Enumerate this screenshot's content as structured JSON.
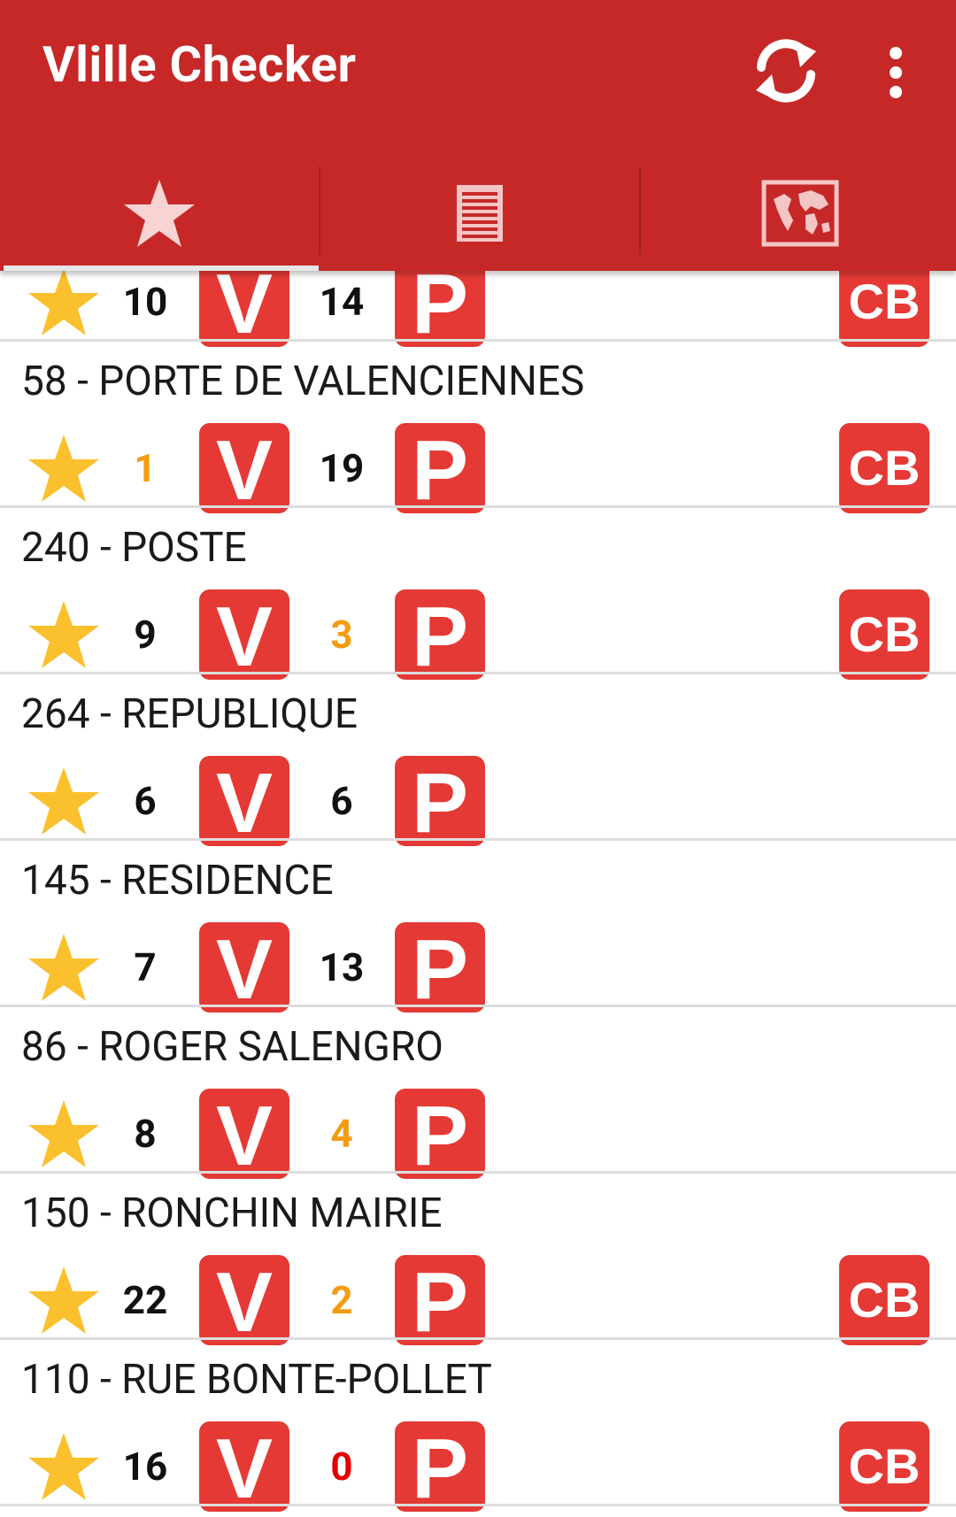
{
  "app": {
    "title": "Vlille Checker",
    "colors": {
      "primary": "#c62828",
      "badge": "#e53935",
      "warning": "#f39c12",
      "empty": "#e00000",
      "star": "#fbc02d"
    }
  },
  "toolbar": {
    "refresh_icon": "refresh-icon",
    "more_icon": "more-vert-icon"
  },
  "tabs": [
    {
      "icon": "star-icon",
      "selected": true
    },
    {
      "icon": "list-icon",
      "selected": false
    },
    {
      "icon": "map-icon",
      "selected": false
    }
  ],
  "badges": {
    "bikes": "V",
    "docks": "P",
    "card": "CB"
  },
  "stations": [
    {
      "title": "",
      "bikes": "10",
      "docks": "14",
      "bikes_color": "#111111",
      "docks_color": "#111111",
      "cb": true
    },
    {
      "title": "58 - PORTE DE VALENCIENNES",
      "bikes": "1",
      "docks": "19",
      "bikes_color": "#f39c12",
      "docks_color": "#111111",
      "cb": true
    },
    {
      "title": "240 - POSTE",
      "bikes": "9",
      "docks": "3",
      "bikes_color": "#111111",
      "docks_color": "#f39c12",
      "cb": true
    },
    {
      "title": "264 - REPUBLIQUE",
      "bikes": "6",
      "docks": "6",
      "bikes_color": "#111111",
      "docks_color": "#111111",
      "cb": false
    },
    {
      "title": "145 - RESIDENCE",
      "bikes": "7",
      "docks": "13",
      "bikes_color": "#111111",
      "docks_color": "#111111",
      "cb": false
    },
    {
      "title": "86 - ROGER SALENGRO",
      "bikes": "8",
      "docks": "4",
      "bikes_color": "#111111",
      "docks_color": "#f39c12",
      "cb": false
    },
    {
      "title": "150 - RONCHIN MAIRIE",
      "bikes": "22",
      "docks": "2",
      "bikes_color": "#111111",
      "docks_color": "#f39c12",
      "cb": true
    },
    {
      "title": "110 - RUE BONTE-POLLET",
      "bikes": "16",
      "docks": "0",
      "bikes_color": "#111111",
      "docks_color": "#e00000",
      "cb": true
    }
  ]
}
